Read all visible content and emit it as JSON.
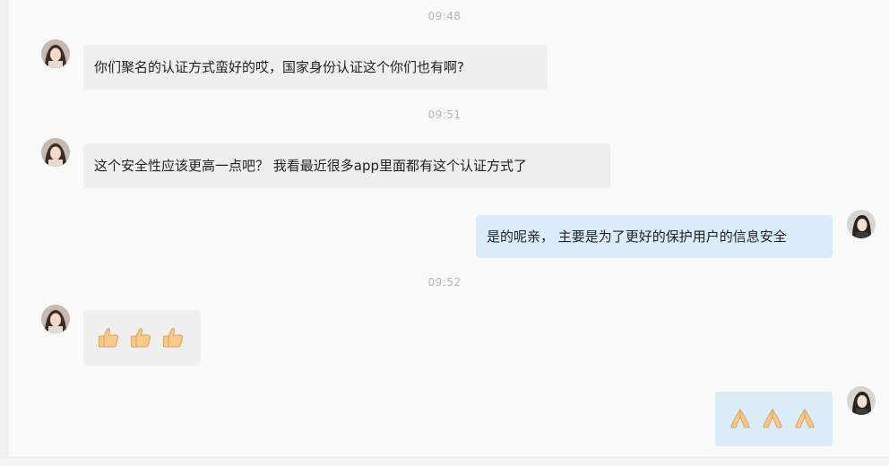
{
  "messages": [
    {
      "time": "09:48"
    },
    {
      "direction": "in",
      "text": "你们聚名的认证方式蛮好的哎，国家身份认证这个你们也有啊?"
    },
    {
      "time": "09:51"
    },
    {
      "direction": "in",
      "text": "这个安全性应该更高一点吧？ 我看最近很多app里面都有这个认证方式了"
    },
    {
      "direction": "out",
      "text": "是的呢亲，  主要是为了更好的保护用户的信息安全"
    },
    {
      "time": "09:52"
    },
    {
      "direction": "in",
      "emoji": [
        "thumbs-up-icon",
        "thumbs-up-icon",
        "thumbs-up-icon"
      ]
    },
    {
      "direction": "out",
      "emoji": [
        "pray-hands-icon",
        "pray-hands-icon",
        "pray-hands-icon"
      ]
    }
  ],
  "colors": {
    "incoming_bubble": "#efefef",
    "outgoing_bubble": "#d9ecf8",
    "timestamp": "#b5b5b5",
    "background": "#fafafa"
  }
}
